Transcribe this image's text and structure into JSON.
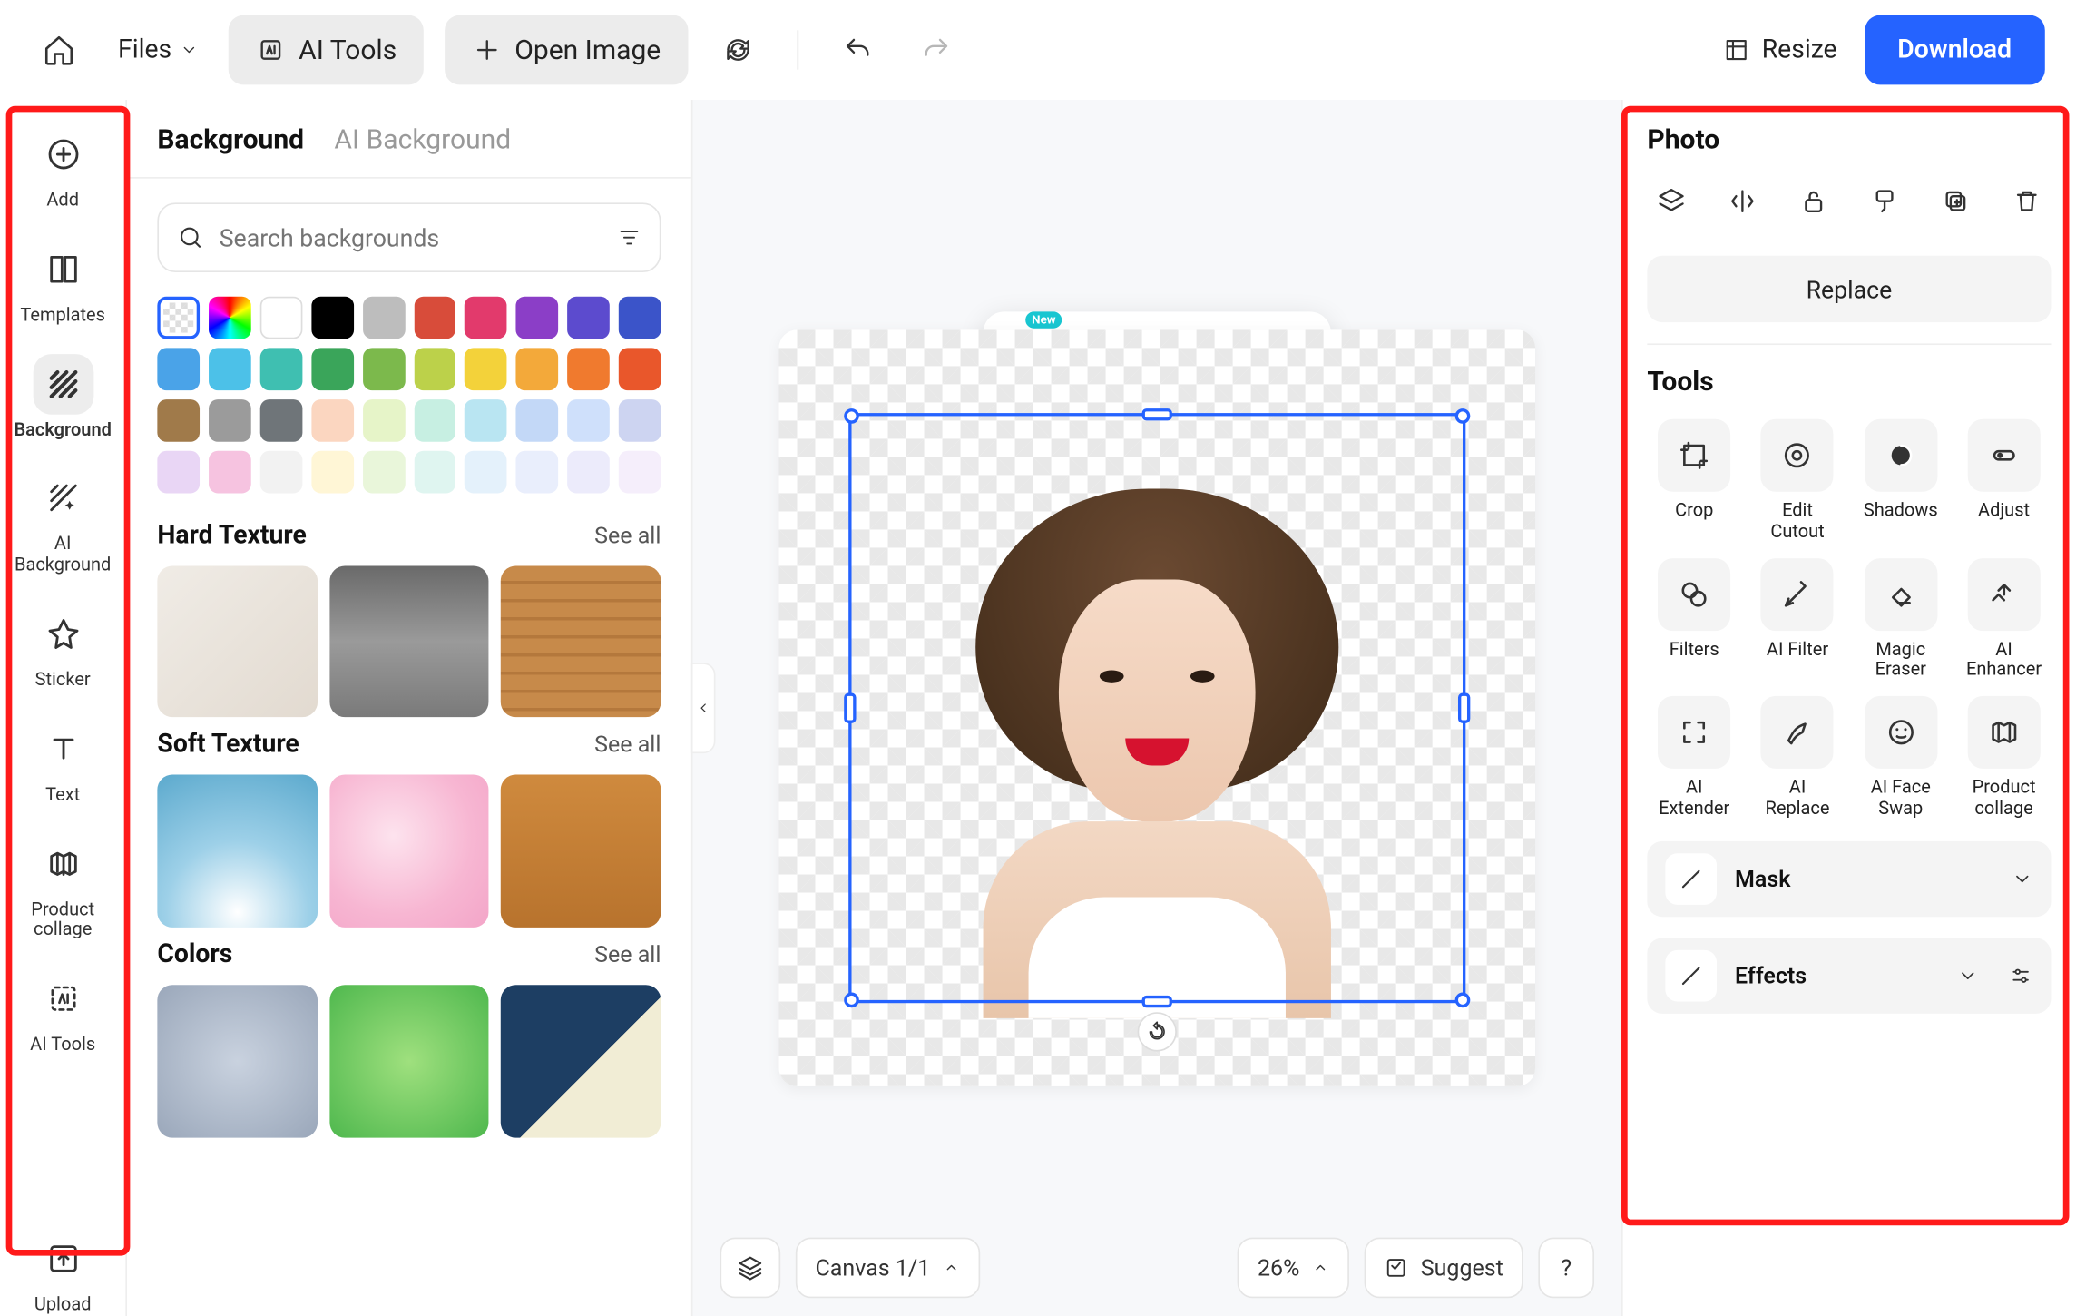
{
  "topbar": {
    "files": "Files",
    "ai_tools": "AI Tools",
    "open_image": "Open Image",
    "resize": "Resize",
    "download": "Download"
  },
  "leftrail": {
    "items": [
      {
        "label": "Add"
      },
      {
        "label": "Templates"
      },
      {
        "label": "Background"
      },
      {
        "label": "AI\nBackground"
      },
      {
        "label": "Sticker"
      },
      {
        "label": "Text"
      },
      {
        "label": "Product\ncollage"
      },
      {
        "label": "AI Tools"
      },
      {
        "label": "Upload"
      }
    ]
  },
  "bgpanel": {
    "tabs": {
      "bg": "Background",
      "aibg": "AI Background"
    },
    "search_placeholder": "Search backgrounds",
    "swatch_colors": [
      "checker",
      "rainbow",
      "#ffffff",
      "#000000",
      "#bdbdbd",
      "#d84c3a",
      "#e23a6c",
      "#8b3ec7",
      "#5c4bce",
      "#3b54c9",
      "#4aa3e8",
      "#4cc1e8",
      "#3fbfb1",
      "#3aa55a",
      "#7cb94c",
      "#bcd14a",
      "#f3d23a",
      "#f3a93a",
      "#f07a2e",
      "#e9572b",
      "#a07a4a",
      "#9b9b9b",
      "#6f7579",
      "#fbd6c0",
      "#e6f4c8",
      "#c7efe2",
      "#b9e5f2",
      "#c3d8f7",
      "#cfe0fb",
      "#cdd4f1",
      "#e9d6f5",
      "#f6c3e0",
      "#f2f2f2",
      "#fff6d6",
      "#e9f6da",
      "#dff5f0",
      "#e4f1fb",
      "#e9eefc",
      "#ecebfb",
      "#f5eefb"
    ],
    "hard": {
      "title": "Hard Texture",
      "see": "See all"
    },
    "soft": {
      "title": "Soft Texture",
      "see": "See all"
    },
    "colors": {
      "title": "Colors",
      "see": "See all"
    }
  },
  "float_toolbar": {
    "badge": "New"
  },
  "canvas_bottom": {
    "canvas": "Canvas 1/1",
    "zoom": "26%",
    "suggest": "Suggest",
    "help": "?"
  },
  "rightpanel": {
    "photo": "Photo",
    "replace": "Replace",
    "tools_title": "Tools",
    "tools": [
      {
        "label": "Crop"
      },
      {
        "label": "Edit\nCutout"
      },
      {
        "label": "Shadows"
      },
      {
        "label": "Adjust"
      },
      {
        "label": "Filters"
      },
      {
        "label": "AI Filter"
      },
      {
        "label": "Magic\nEraser"
      },
      {
        "label": "AI\nEnhancer"
      },
      {
        "label": "AI\nExtender"
      },
      {
        "label": "AI\nReplace"
      },
      {
        "label": "AI Face\nSwap"
      },
      {
        "label": "Product\ncollage"
      }
    ],
    "mask": "Mask",
    "effects": "Effects"
  }
}
